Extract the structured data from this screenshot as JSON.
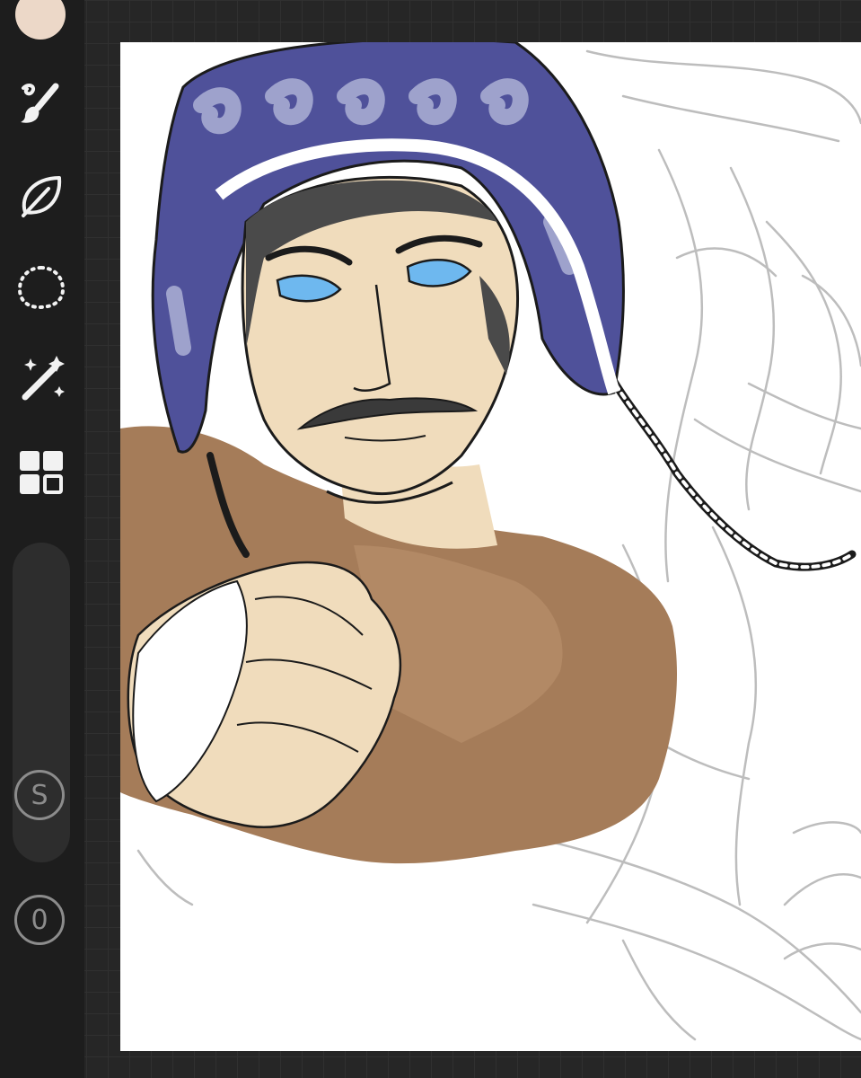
{
  "toolbar": {
    "current_color": "#ecd8c8",
    "tools": [
      {
        "name": "brush-icon"
      },
      {
        "name": "leaf-shape-icon"
      },
      {
        "name": "lasso-selection-icon"
      },
      {
        "name": "magic-wand-icon"
      },
      {
        "name": "layers-grid-icon"
      }
    ],
    "size_button_label": "S",
    "opacity_button_label": "0"
  },
  "colors": {
    "background": "#262626",
    "toolbar": "#1d1d1d",
    "hat_blue": "#4f519a",
    "hat_pattern": "#9ea2cc",
    "skin": "#f0dcbc",
    "shirt_brown": "#a37a57",
    "eye_blue": "#6eb8ef",
    "sketch_gray": "#b8b8b8"
  }
}
